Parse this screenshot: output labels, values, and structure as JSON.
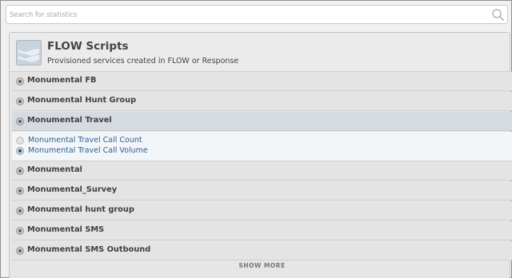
{
  "search": {
    "placeholder": "Search for statistics",
    "value": ""
  },
  "panel": {
    "title": "FLOW Scripts",
    "subtitle": "Provisioned services created in FLOW or Response"
  },
  "rows": [
    {
      "label": "Monumental FB"
    },
    {
      "label": "Monumental Hunt Group"
    },
    {
      "label": "Monumental Travel",
      "expanded": true
    },
    {
      "label": "Monumental"
    },
    {
      "label": "Monumental_Survey"
    },
    {
      "label": "Monumental hunt group"
    },
    {
      "label": "Monumental SMS"
    },
    {
      "label": "Monumental SMS Outbound"
    }
  ],
  "sub_items": [
    {
      "label": "Monumental Travel Call Count",
      "selected": false
    },
    {
      "label": "Monumental Travel Call Volume",
      "selected": true
    }
  ],
  "show_more": "SHOW MORE",
  "colors": {
    "link": "#2b5e8f",
    "expanded_row": "#d5dbe0",
    "panel": "#e6e6e6"
  }
}
